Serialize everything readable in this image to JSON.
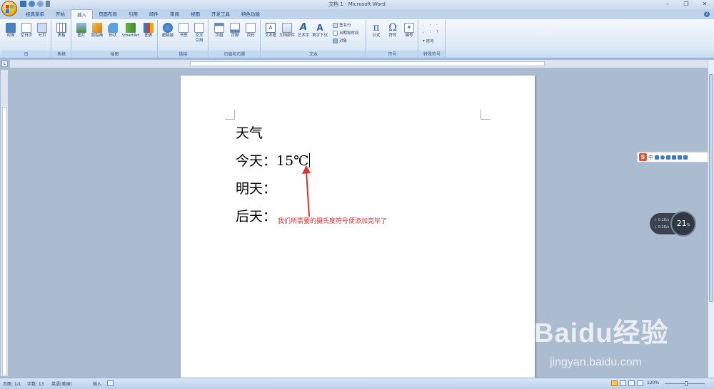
{
  "window": {
    "title": "文档 1 - Microsoft Word"
  },
  "tabs": [
    "经典菜单",
    "开始",
    "插入",
    "页面布局",
    "引用",
    "邮件",
    "审阅",
    "视图",
    "开发工具",
    "特色功能"
  ],
  "active_tab": "插入",
  "ribbon": {
    "groups": {
      "pages": {
        "label": "页",
        "cover": "封面",
        "blank": "空白页",
        "break": "分页"
      },
      "tables": {
        "label": "表格",
        "table": "表格"
      },
      "illustrations": {
        "label": "插图",
        "picture": "图片",
        "clipart": "剪贴画",
        "shapes": "形状",
        "smartart": "SmartArt",
        "chart": "图表"
      },
      "links": {
        "label": "链接",
        "hyperlink": "超链接",
        "bookmark": "书签",
        "crossref": "交叉引用"
      },
      "header_footer": {
        "label": "页眉和页脚",
        "header": "页眉",
        "footer": "页脚",
        "page_number": "页码"
      },
      "text": {
        "label": "文本",
        "textbox": "文本框",
        "quickparts": "文档部件",
        "wordart": "艺术字",
        "dropcap": "首字下沉",
        "signature": "签名行",
        "datetime": "日期和时间",
        "object": "对象"
      },
      "symbols": {
        "label": "符号",
        "equation": "公式",
        "symbol": "符号",
        "number": "编号"
      },
      "special": {
        "label": "特殊符号",
        "symbol_btn": "符号"
      }
    }
  },
  "document": {
    "lines": [
      "天气",
      "今天：15℃",
      "明天：",
      "后天："
    ]
  },
  "annotation": "我们所需要的摄氏度符号便添加完毕了",
  "ime": {
    "lang": "中"
  },
  "speed_widget": {
    "up": "0.1K/s",
    "down": "0.1K/s",
    "percent": "21"
  },
  "watermark": {
    "brand": "Baidu经验",
    "url": "jingyan.baidu.com"
  },
  "statusbar": {
    "page": "页面: 1/1",
    "words": "字数: 13",
    "language": "英语(美国)",
    "mode": "插入",
    "zoom": "120%"
  },
  "colors": {
    "accent": "#e62e2e",
    "ribbon": "#dde9f7",
    "workspace": "#abbbd0"
  }
}
